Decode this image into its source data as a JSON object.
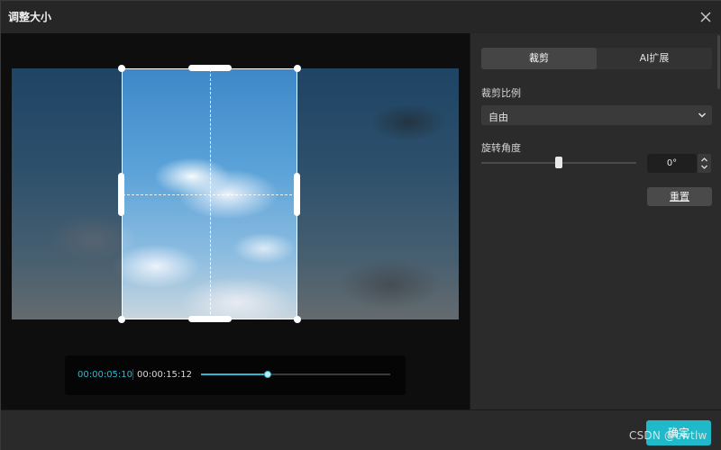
{
  "window": {
    "title": "调整大小"
  },
  "preview": {
    "current_time": "00:00:05:10",
    "total_time": "00:00:15:12",
    "progress": 0.35
  },
  "panel": {
    "tabs": [
      {
        "label": "裁剪",
        "active": true
      },
      {
        "label": "AI扩展",
        "active": false
      }
    ],
    "crop_ratio_label": "裁剪比例",
    "crop_ratio_value": "自由",
    "rotation_label": "旋转角度",
    "rotation_value": "0°",
    "rotation_slider_position": 0.5,
    "reset_label": "重置"
  },
  "footer": {
    "confirm_label": "确定",
    "watermark": "CSDN @cwtlw"
  },
  "colors": {
    "accent": "#1fb9c9",
    "time_accent": "#2fb8d0"
  }
}
